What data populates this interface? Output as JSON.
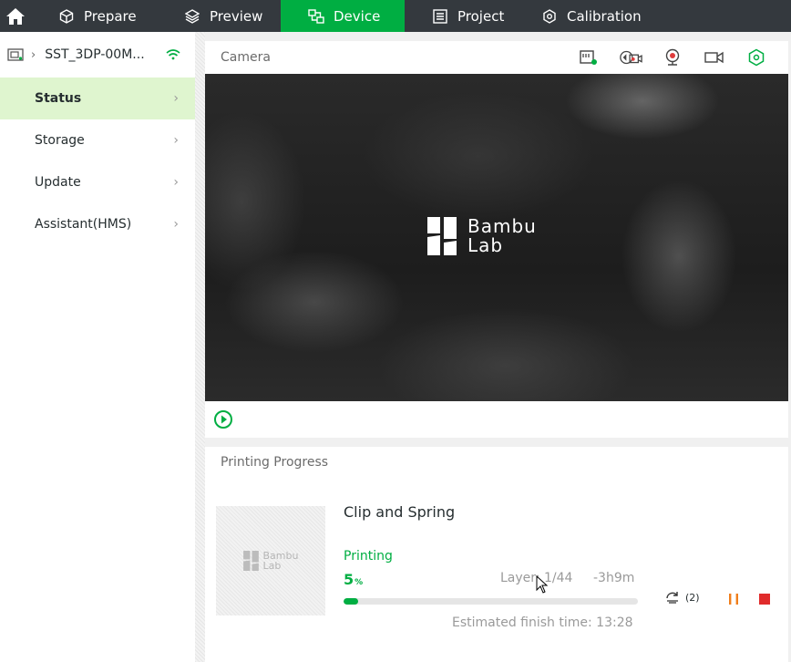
{
  "nav": {
    "tabs": [
      {
        "label": "Prepare",
        "icon": "cube-icon",
        "active": false
      },
      {
        "label": "Preview",
        "icon": "layers-icon",
        "active": false
      },
      {
        "label": "Device",
        "icon": "device-icon",
        "active": true
      },
      {
        "label": "Project",
        "icon": "project-icon",
        "active": false
      },
      {
        "label": "Calibration",
        "icon": "calibration-icon",
        "active": false
      }
    ],
    "accent": "#00ae42",
    "bar_color": "#34393e"
  },
  "sidebar": {
    "device_name": "SST_3DP-00M...",
    "items": [
      {
        "label": "Status",
        "active": true
      },
      {
        "label": "Storage",
        "active": false
      },
      {
        "label": "Update",
        "active": false
      },
      {
        "label": "Assistant(HMS)",
        "active": false
      }
    ]
  },
  "camera": {
    "title": "Camera",
    "logo_line1": "Bambu",
    "logo_line2": "Lab"
  },
  "progress": {
    "title": "Printing Progress",
    "job_name": "Clip and Spring",
    "state": "Printing",
    "percent_value": "5",
    "percent_sign": "%",
    "percent": 5,
    "layer": "Layer: 1/44",
    "remaining": "-3h9m",
    "retry_count": "(2)",
    "finish_time": "Estimated finish time: 13:28",
    "thumb_logo_line1": "Bambu",
    "thumb_logo_line2": "Lab"
  }
}
